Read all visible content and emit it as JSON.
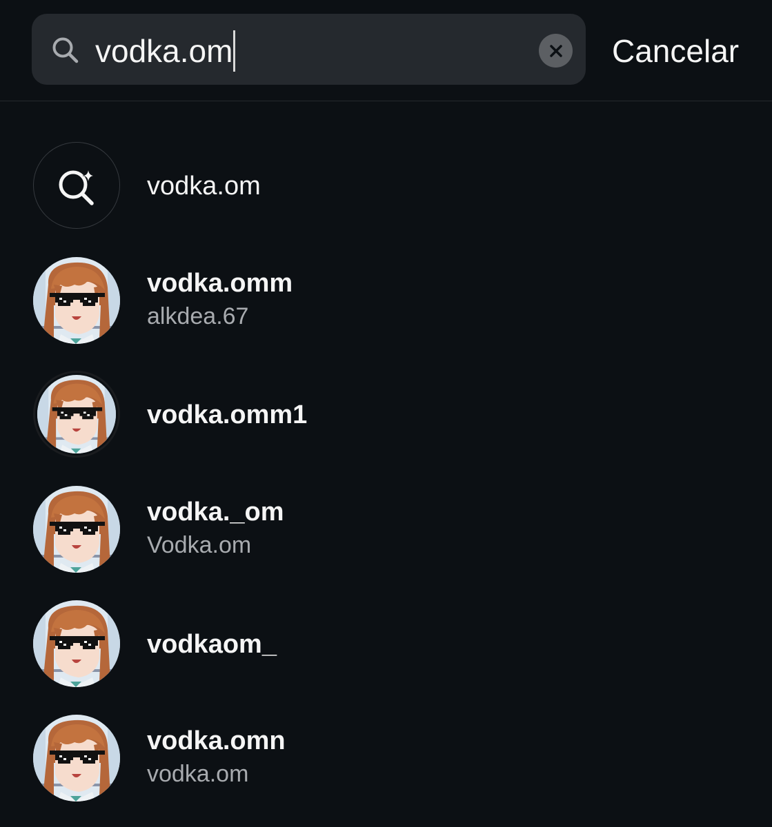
{
  "search": {
    "query": "vodka.om",
    "cancel_label": "Cancelar"
  },
  "keyword_suggestion": {
    "text": "vodka.om",
    "icon": "sparkle-search-icon"
  },
  "results": [
    {
      "username": "vodka.omm",
      "subtitle": "alkdea.67",
      "story_ring": false
    },
    {
      "username": "vodka.omm1",
      "subtitle": "",
      "story_ring": true
    },
    {
      "username": "vodka._om",
      "subtitle": "Vodka.om",
      "story_ring": false
    },
    {
      "username": "vodkaom_",
      "subtitle": "",
      "story_ring": false
    },
    {
      "username": "vodka.omn",
      "subtitle": "vodka.om",
      "story_ring": false
    }
  ],
  "colors": {
    "background": "#0c1014",
    "search_field": "#25292e",
    "primary_text": "#f5f5f5",
    "secondary_text": "#a8abaf",
    "clear_button": "#5c5f63"
  }
}
